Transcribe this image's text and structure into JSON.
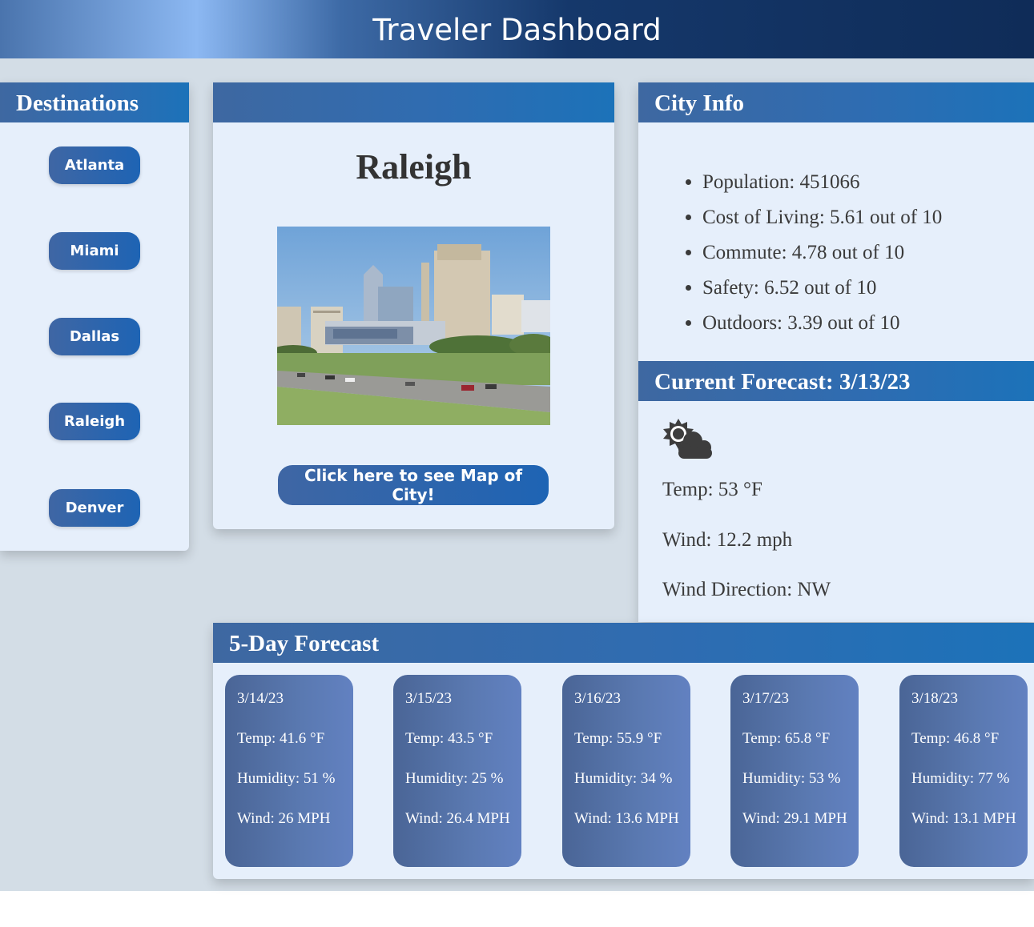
{
  "header": {
    "title": "Traveler Dashboard"
  },
  "destinations": {
    "heading": "Destinations",
    "cities": [
      "Atlanta",
      "Miami",
      "Dallas",
      "Raleigh",
      "Denver"
    ]
  },
  "city_card": {
    "name": "Raleigh",
    "map_button": "Click here to see Map of City!"
  },
  "city_info": {
    "heading": "City Info",
    "stats": [
      "Population: 451066",
      "Cost of Living: 5.61 out of 10",
      "Commute: 4.78 out of 10",
      "Safety: 6.52 out of 10",
      "Outdoors: 3.39 out of 10"
    ]
  },
  "current_forecast": {
    "heading": "Current Forecast: 3/13/23",
    "icon": "partly-cloudy-icon",
    "temp": "Temp: 53 °F",
    "wind": "Wind: 12.2 mph",
    "wind_direction": "Wind Direction: NW"
  },
  "five_day": {
    "heading": "5-Day Forecast",
    "days": [
      {
        "date": "3/14/23",
        "temp": "Temp: 41.6 °F",
        "humidity": "Humidity: 51 %",
        "wind": "Wind: 26 MPH"
      },
      {
        "date": "3/15/23",
        "temp": "Temp: 43.5 °F",
        "humidity": "Humidity: 25 %",
        "wind": "Wind: 26.4 MPH"
      },
      {
        "date": "3/16/23",
        "temp": "Temp: 55.9 °F",
        "humidity": "Humidity: 34 %",
        "wind": "Wind: 13.6 MPH"
      },
      {
        "date": "3/17/23",
        "temp": "Temp: 65.8 °F",
        "humidity": "Humidity: 53 %",
        "wind": "Wind: 29.1 MPH"
      },
      {
        "date": "3/18/23",
        "temp": "Temp: 46.8 °F",
        "humidity": "Humidity: 77 %",
        "wind": "Wind: 13.1 MPH"
      }
    ]
  }
}
